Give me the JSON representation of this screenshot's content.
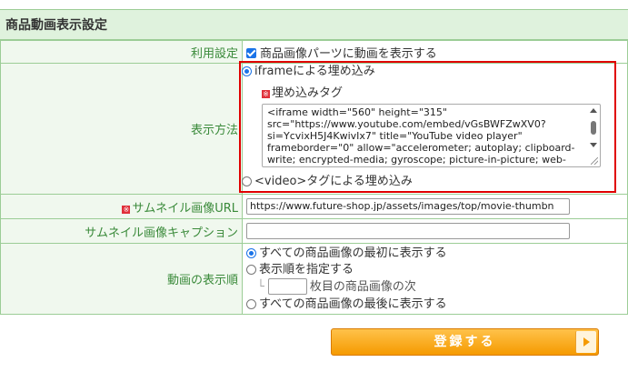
{
  "section_title": "商品動画表示設定",
  "rows": {
    "usage": {
      "label": "利用設定",
      "checkbox_label": "商品画像パーツに動画を表示する",
      "checked": true
    },
    "display_method": {
      "label": "表示方法",
      "option_iframe": "iframeによる埋め込み",
      "embed_tag_label": "埋め込みタグ",
      "embed_tag_lines": [
        "<iframe width=\"560\" height=\"315\"",
        "src=\"https://www.youtube.com/embed/vGsBWFZwXV0?",
        "si=YcvixH5J4KwivIx7\" title=\"YouTube video player\"",
        "frameborder=\"0\" allow=\"accelerometer; autoplay; clipboard-",
        "write; encrypted-media; gyroscope; picture-in-picture; web-"
      ],
      "option_video": "<video>タグによる埋め込み",
      "selected": "iframe"
    },
    "thumbnail_url": {
      "label": "サムネイル画像URL",
      "value": "https://www.future-shop.jp/assets/images/top/movie-thumbn"
    },
    "thumbnail_caption": {
      "label": "サムネイル画像キャプション",
      "value": ""
    },
    "display_order": {
      "label": "動画の表示順",
      "option_first": "すべての商品画像の最初に表示する",
      "option_specify": "表示順を指定する",
      "after_suffix": "枚目の商品画像の次",
      "after_value": "",
      "option_last": "すべての商品画像の最後に表示する",
      "selected": "first"
    }
  },
  "required_mark": "※",
  "submit_label": "登録する",
  "colors": {
    "header_bg": "#dff2dd",
    "label_bg": "#f0f8ee",
    "label_text": "#3a8a3a",
    "border": "#9ccd96",
    "highlight": "#e00000",
    "submit": "#f59a00"
  }
}
